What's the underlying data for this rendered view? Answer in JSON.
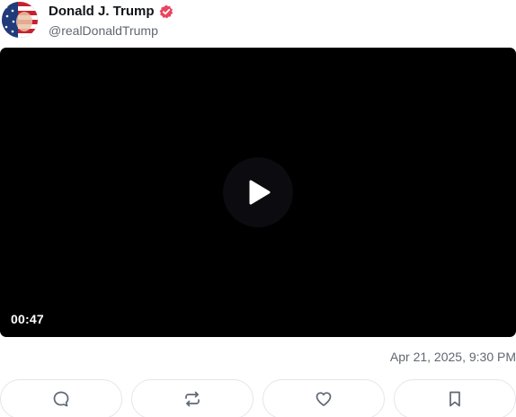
{
  "post": {
    "author_name": "Donald J. Trump",
    "handle": "@realDonaldTrump",
    "timestamp": "Apr 21, 2025, 9:30 PM"
  },
  "video": {
    "duration": "00:47"
  },
  "icons": {
    "verified": "verified-badge-icon",
    "play": "play-icon",
    "reply": "comment-icon",
    "repost": "repost-icon",
    "like": "heart-icon",
    "bookmark": "bookmark-icon"
  },
  "colors": {
    "verified_badge": "#e8455f",
    "video_background": "#000000",
    "icon_gray": "#5f6773"
  }
}
